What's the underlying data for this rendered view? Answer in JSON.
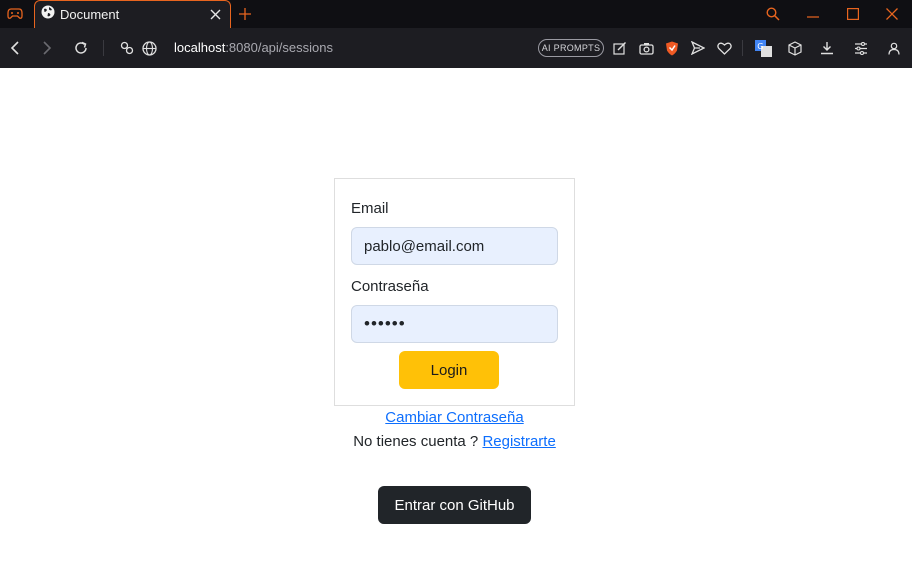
{
  "browser": {
    "tab": {
      "title": "Document",
      "icon": "globe-icon"
    },
    "url": {
      "host": "localhost",
      "path": ":8080/api/sessions"
    },
    "ai_prompts_label": "AI PROMPTS",
    "accent_color": "#e8651f"
  },
  "form": {
    "email_label": "Email",
    "email_value": "pablo@email.com",
    "password_label": "Contraseña",
    "password_masked": "••••••",
    "login_label": "Login"
  },
  "links": {
    "change_password": "Cambiar Contraseña",
    "no_account_text": "No tienes cuenta ?",
    "register": "Registrarte"
  },
  "github_button_label": "Entrar con GitHub",
  "colors": {
    "login_button": "#ffc107",
    "github_button": "#212529",
    "link": "#0d6efd",
    "autofill_field": "#e8f0fe"
  }
}
